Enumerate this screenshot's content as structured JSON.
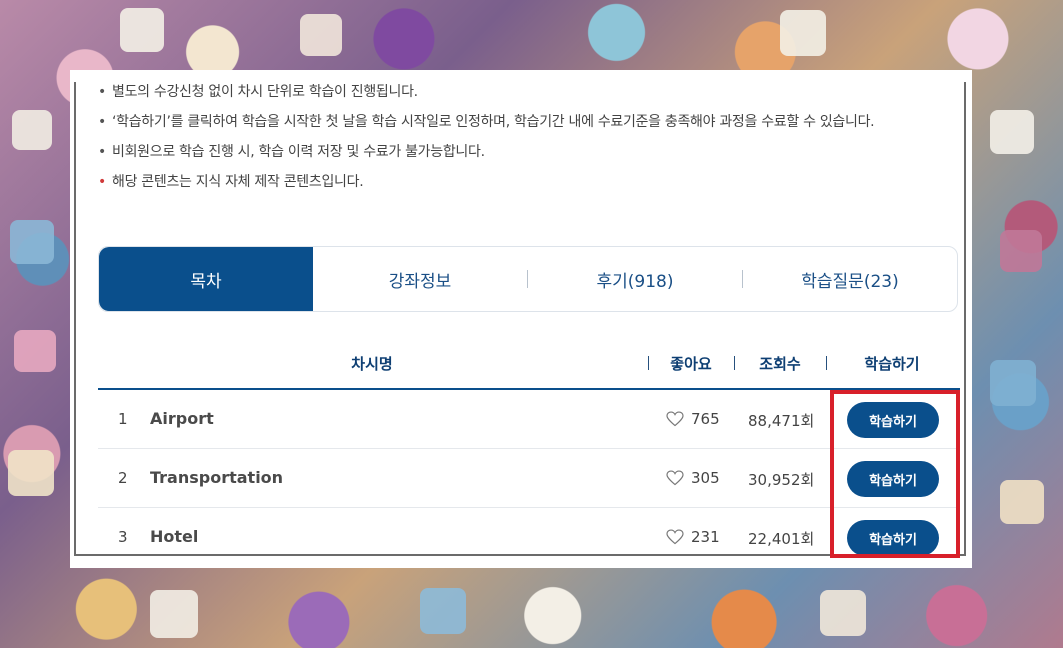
{
  "notes": [
    {
      "text": "별도의 수강신청 없이 차시 단위로 학습이 진행됩니다.",
      "bullet": "•",
      "color": "#555555"
    },
    {
      "text": "‘학습하기’를 클릭하여 학습을 시작한 첫 날을 학습 시작일로 인정하며, 학습기간 내에 수료기준을 충족해야 과정을 수료할 수 있습니다.",
      "bullet": "•",
      "color": "#555555"
    },
    {
      "text": "비회원으로 학습 진행 시, 학습 이력 저장 및 수료가 불가능합니다.",
      "bullet": "•",
      "color": "#555555"
    },
    {
      "text": "해당 콘텐츠는 지식 자체 제작 콘텐츠입니다.",
      "bullet": "•",
      "color": "#d03a3a"
    }
  ],
  "tabs": {
    "toc": "목차",
    "course_info": "강좌정보",
    "reviews": "후기(918)",
    "qna": "학습질문(23)"
  },
  "table": {
    "headers": {
      "title": "차시명",
      "likes": "좋아요",
      "views": "조회수",
      "action": "학습하기"
    },
    "rows": [
      {
        "no": "1",
        "title": "Airport",
        "likes": "765",
        "views": "88,471회",
        "action": "학습하기"
      },
      {
        "no": "2",
        "title": "Transportation",
        "likes": "305",
        "views": "30,952회",
        "action": "학습하기"
      },
      {
        "no": "3",
        "title": "Hotel",
        "likes": "231",
        "views": "22,401회",
        "action": "학습하기"
      }
    ]
  },
  "colors": {
    "accent": "#0a4f8c",
    "highlight": "#d8202a"
  }
}
